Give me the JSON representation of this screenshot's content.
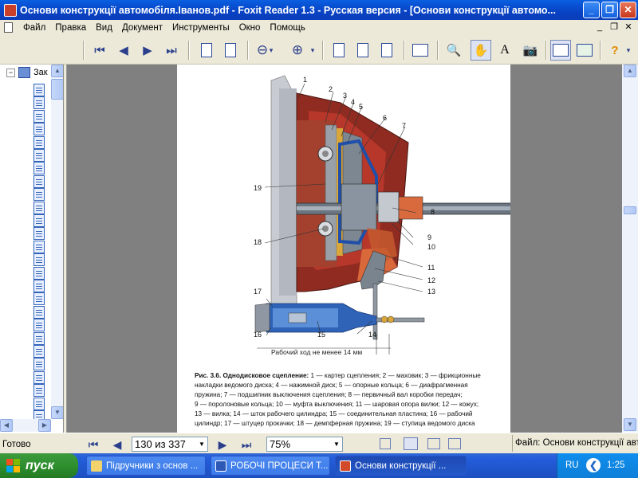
{
  "window": {
    "title": "Основи конструкції автомобіля.Іванов.pdf - Foxit Reader 1.3 - Русская версия  - [Основи конструкції автомо...",
    "minimize_glyph": "_",
    "restore_glyph": "❐",
    "close_glyph": "✕"
  },
  "menu": {
    "items": [
      "Файл",
      "Правка",
      "Вид",
      "Документ",
      "Инструменты",
      "Окно",
      "Помощь"
    ],
    "mdi_min": "_",
    "mdi_restore": "❐",
    "mdi_close": "✕"
  },
  "toolbar": {
    "icons": [
      "first-page-icon",
      "prev-page-icon",
      "next-page-icon",
      "last-page-icon",
      "rotate-left-icon",
      "rotate-right-icon",
      "zoom-out-icon",
      "zoom-in-icon",
      "actual-size-icon",
      "fit-page-icon",
      "fit-width-icon",
      "single-page-icon",
      "find-icon",
      "hand-tool-icon",
      "select-text-icon",
      "snapshot-icon",
      "bookmarks-panel-icon",
      "export-icon",
      "help-icon"
    ]
  },
  "bookmarks": {
    "root_label": "Зак",
    "expander": "−"
  },
  "figure": {
    "labels": [
      "1",
      "2",
      "3",
      "4",
      "5",
      "6",
      "7",
      "8",
      "9",
      "10",
      "11",
      "12",
      "13",
      "14",
      "15",
      "16",
      "17",
      "18",
      "19"
    ],
    "stroke_note": "Рабочий ход не менее 14 мм",
    "caption_prefix": "Рис. 3.6.",
    "caption_title": "Однодисковое сцепление:",
    "caption_lines": [
      " 1 — картер сцепления; 2 — маховик; 3 — фрикционные",
      "накладки ведомого диска; 4 — нажимной диск; 5 — опорные кольца; 6 — диафрагменная",
      "пружина; 7 — подшипник выключения сцепления; 8 — первичный вал коробки передач;",
      "9 — поролоновые кольца; 10 — муфта выключения; 11 — шаровая опора вилки; 12 — кожух;",
      "13 — вилка; 14 — шток рабочего цилиндра; 15 — соединительная пластина; 16 — рабочий",
      "цилиндр; 17 — штуцер прокачки; 18 — демпферная пружина; 19 — ступица ведомого диска"
    ]
  },
  "statusbar": {
    "ready": "Готово",
    "page_display": "130 из 337",
    "zoom": "75%",
    "file_text": "Файл: Основи конструкції автомобіля.Іванов.pdf"
  },
  "taskbar": {
    "start": "пуск",
    "tasks": [
      {
        "label": "Підручники з основ ...",
        "icon_color": "#f3d36b"
      },
      {
        "label": "РОБОЧІ ПРОЦЕСИ Т...",
        "icon_color": "#2d58b6"
      },
      {
        "label": "Основи конструкції ...",
        "icon_color": "#d24a2a"
      }
    ],
    "lang": "RU",
    "clock": "1:25"
  }
}
